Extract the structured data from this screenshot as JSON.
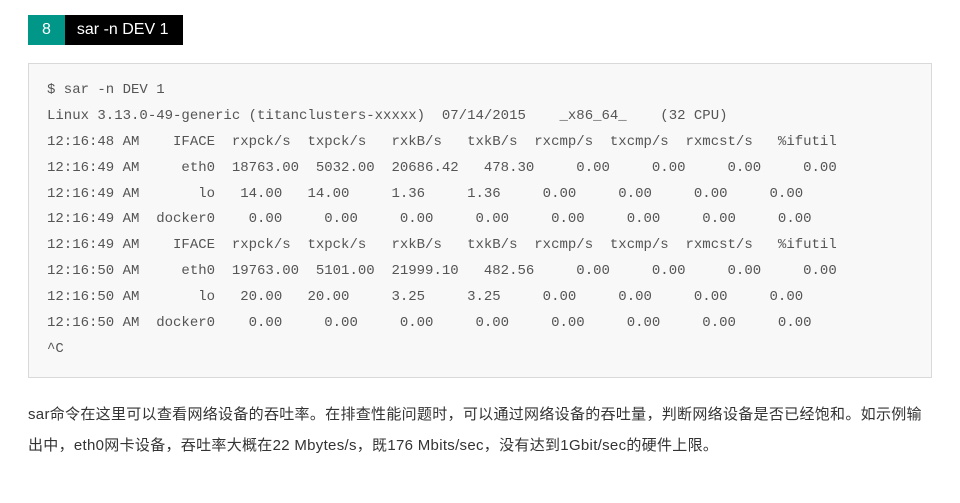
{
  "section": {
    "number": "8",
    "title": "sar -n DEV 1"
  },
  "code": {
    "prompt": "$ sar -n DEV 1",
    "sysline": "Linux 3.13.0-49-generic (titanclusters-xxxxx)  07/14/2015    _x86_64_    (32 CPU)",
    "header1": "12:16:48 AM    IFACE  rxpck/s  txpck/s   rxkB/s   txkB/s  rxcmp/s  txcmp/s  rxmcst/s   %ifutil",
    "r1": "12:16:49 AM     eth0  18763.00  5032.00  20686.42   478.30     0.00     0.00     0.00     0.00",
    "r2": "12:16:49 AM       lo   14.00   14.00     1.36     1.36     0.00     0.00     0.00     0.00",
    "r3": "12:16:49 AM  docker0    0.00     0.00     0.00     0.00     0.00     0.00     0.00     0.00",
    "header2": "12:16:49 AM    IFACE  rxpck/s  txpck/s   rxkB/s   txkB/s  rxcmp/s  txcmp/s  rxmcst/s   %ifutil",
    "r4": "12:16:50 AM     eth0  19763.00  5101.00  21999.10   482.56     0.00     0.00     0.00     0.00",
    "r5": "12:16:50 AM       lo   20.00   20.00     3.25     3.25     0.00     0.00     0.00     0.00",
    "r6": "12:16:50 AM  docker0    0.00     0.00     0.00     0.00     0.00     0.00     0.00     0.00",
    "interrupt": "^C"
  },
  "explanation": "sar命令在这里可以查看网络设备的吞吐率。在排查性能问题时，可以通过网络设备的吞吐量，判断网络设备是否已经饱和。如示例输出中，eth0网卡设备，吞吐率大概在22 Mbytes/s，既176 Mbits/sec，没有达到1Gbit/sec的硬件上限。"
}
